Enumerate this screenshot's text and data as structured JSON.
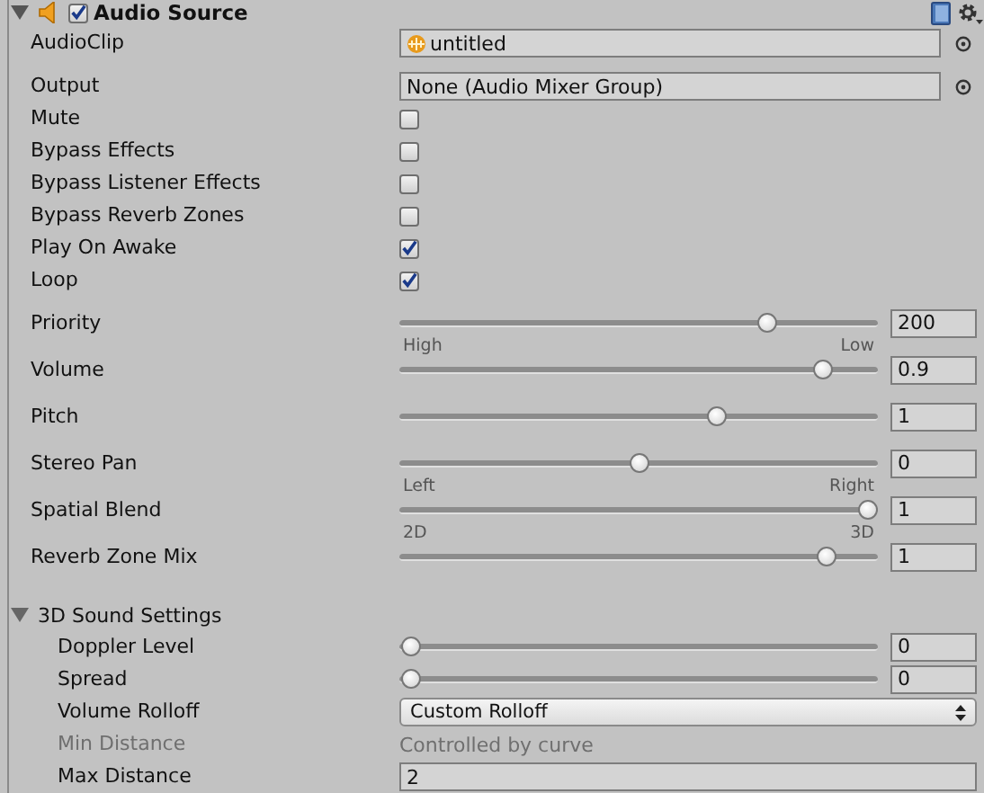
{
  "header": {
    "title": "Audio Source",
    "enabled": true,
    "expanded": true
  },
  "groups": [
    [
      {
        "kind": "object",
        "label": "AudioClip",
        "value": "untitled",
        "asset": true
      }
    ],
    [
      {
        "kind": "object",
        "label": "Output",
        "value": "None (Audio Mixer Group)",
        "asset": false
      },
      {
        "kind": "checkbox",
        "label": "Mute",
        "checked": false
      },
      {
        "kind": "checkbox",
        "label": "Bypass Effects",
        "checked": false
      },
      {
        "kind": "checkbox",
        "label": "Bypass Listener Effects",
        "checked": false
      },
      {
        "kind": "checkbox",
        "label": "Bypass Reverb Zones",
        "checked": false
      },
      {
        "kind": "checkbox",
        "label": "Play On Awake",
        "checked": true
      },
      {
        "kind": "checkbox",
        "label": "Loop",
        "checked": true
      }
    ],
    [
      {
        "kind": "slider",
        "label": "Priority",
        "level": 0.78,
        "value": "200",
        "min_label": "High",
        "max_label": "Low"
      },
      {
        "kind": "slider",
        "label": "Volume",
        "level": 0.9,
        "value": "0.9"
      },
      {
        "kind": "slider",
        "label": "Pitch",
        "level": 0.67,
        "value": "1"
      },
      {
        "kind": "slider",
        "label": "Stereo Pan",
        "level": 0.5,
        "value": "0",
        "min_label": "Left",
        "max_label": "Right"
      },
      {
        "kind": "slider",
        "label": "Spatial Blend",
        "level": 1,
        "value": "1",
        "min_label": "2D",
        "max_label": "3D"
      },
      {
        "kind": "slider",
        "label": "Reverb Zone Mix",
        "level": 0.91,
        "value": "1"
      }
    ]
  ],
  "section": {
    "title": "3D Sound Settings",
    "expanded": true,
    "rows": [
      {
        "kind": "slider",
        "label": "Doppler Level",
        "level": 0,
        "value": "0"
      },
      {
        "kind": "slider",
        "label": "Spread",
        "level": 0,
        "value": "0"
      },
      {
        "kind": "dropdown",
        "label": "Volume Rolloff",
        "value": "Custom Rolloff"
      },
      {
        "kind": "readonly",
        "label": "Min Distance",
        "value": "Controlled by curve"
      },
      {
        "kind": "number",
        "label": "Max Distance",
        "value": "2"
      }
    ]
  }
}
